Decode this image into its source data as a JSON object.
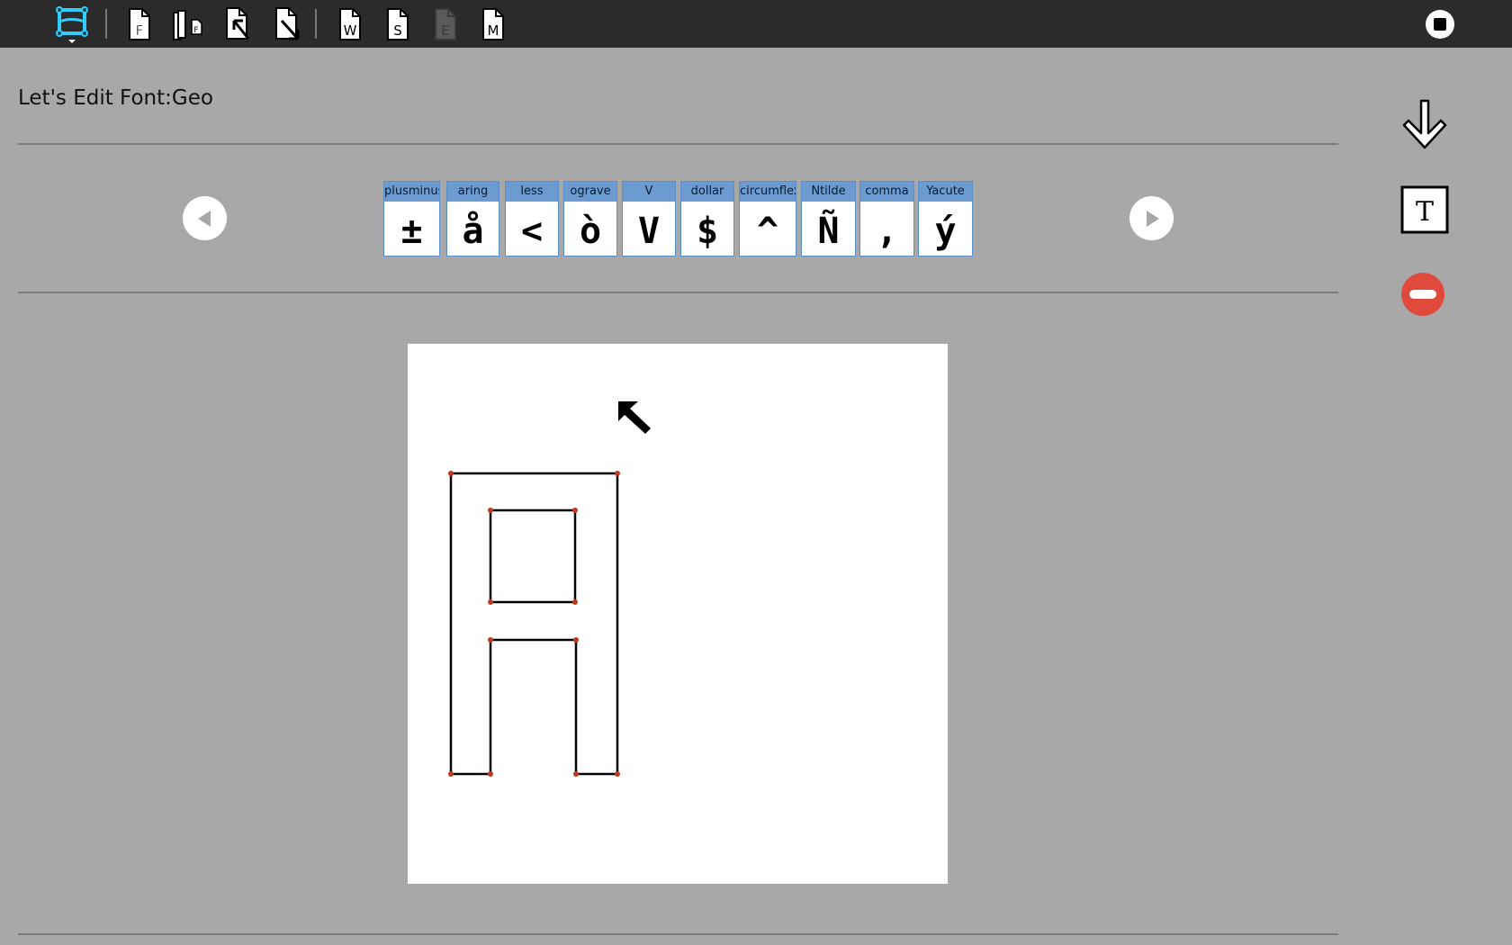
{
  "app": {
    "title": "Let's Edit Font:Geo"
  },
  "toolbar": {
    "items": [
      {
        "name": "activity-icon",
        "letter": ""
      },
      {
        "name": "font-doc",
        "letter": "F"
      },
      {
        "name": "import-doc",
        "letter": "F"
      },
      {
        "name": "open-doc",
        "letter": ""
      },
      {
        "name": "save-doc",
        "letter": ""
      },
      {
        "name": "w-doc",
        "letter": "W"
      },
      {
        "name": "s-doc",
        "letter": "S"
      },
      {
        "name": "e-doc",
        "letter": "E"
      },
      {
        "name": "m-doc",
        "letter": "M"
      }
    ],
    "stop_label": "Stop"
  },
  "glyphs": [
    {
      "name": "plusminus",
      "char": "±"
    },
    {
      "name": "aring",
      "char": "å"
    },
    {
      "name": "less",
      "char": "<"
    },
    {
      "name": "ograve",
      "char": "ò"
    },
    {
      "name": "V",
      "char": "V"
    },
    {
      "name": "dollar",
      "char": "$"
    },
    {
      "name": "circumflex",
      "char": "^"
    },
    {
      "name": "Ntilde",
      "char": "Ñ"
    },
    {
      "name": "comma",
      "char": ","
    },
    {
      "name": "Yacute",
      "char": "ý"
    }
  ],
  "colors": {
    "background": "#a8a8a8",
    "toolbar": "#2b2b2b",
    "glyph_header": "#6b9bd1",
    "point": "#c0391b",
    "delete": "#e04a3c",
    "accent_icon": "#33ccff"
  }
}
